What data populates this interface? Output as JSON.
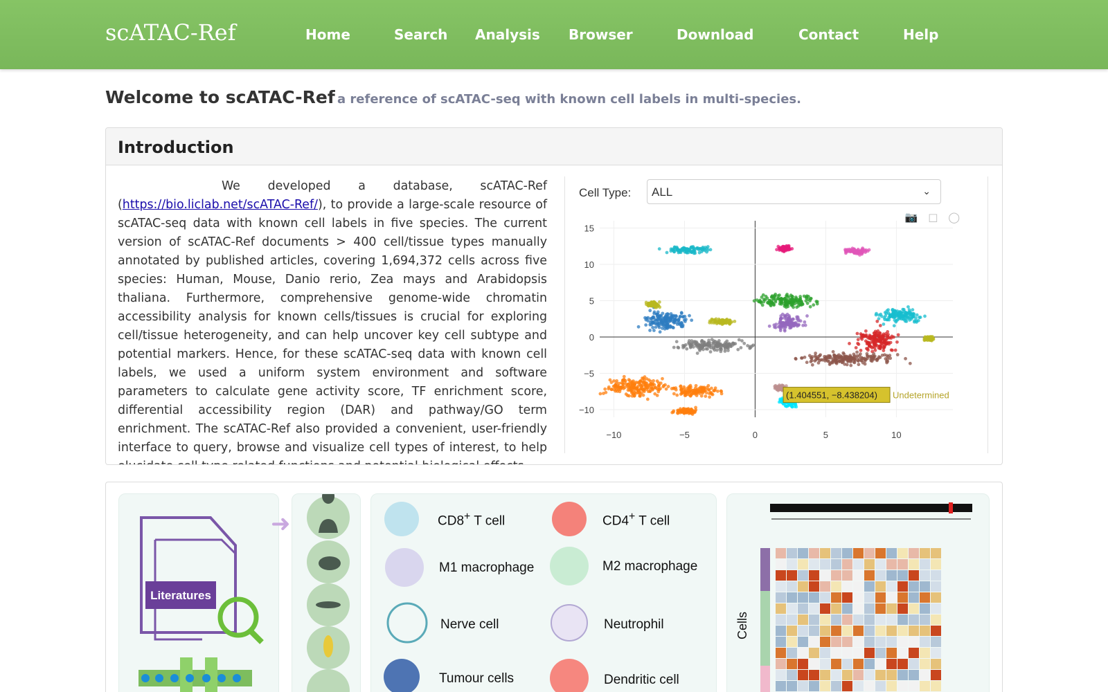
{
  "brand": "scATAC-Ref",
  "nav": [
    "Home",
    "Search",
    "Analysis",
    "Browser",
    "Download",
    "Contact",
    "Help"
  ],
  "welcome": {
    "title": "Welcome to scATAC-Ref",
    "subtitle": "a reference of scATAC-seq with known cell labels in multi-species."
  },
  "intro": {
    "heading": "Introduction",
    "text_before": "We developed a database, scATAC-Ref (",
    "link": "https://bio.liclab.net/scATAC-Ref/",
    "text_after": "), to provide a large-scale resource of scATAC-seq data with known cell labels in five species. The current version of scATAC-Ref documents > 400 cell/tissue types manually annotated by published articles, covering 1,694,372 cells across five species: Human, Mouse, Danio rerio, Zea mays and Arabidopsis thaliana. Furthermore, comprehensive genome-wide chromatin accessibility analysis for known cells/tissues is crucial for exploring cell/tissue heterogeneity, and can help uncover key cell subtype and potential markers. Hence, for these scATAC-seq data with known cell labels, we used a uniform system environment and software parameters to calculate gene activity score, TF enrichment score, differential accessibility region (DAR) and pathway/GO term enrichment. The scATAC-Ref also provided a convenient, user-friendly interface to query, browse and visualize cell types of interest, to help elucidate cell type related functions and potential biological effects."
  },
  "celltype": {
    "label": "Cell Type:",
    "value": "ALL"
  },
  "tooltip": {
    "text": "(1.404551, −8.438204)",
    "label": "Undetermined"
  },
  "chart_data": {
    "type": "scatter",
    "title": "",
    "xlabel": "",
    "ylabel": "",
    "xlim": [
      -11,
      14
    ],
    "ylim": [
      -12,
      16
    ],
    "x_ticks": [
      "−10",
      "−5",
      "0",
      "5",
      "10"
    ],
    "y_ticks": [
      "15",
      "10",
      "5",
      "0",
      "−5",
      "−10"
    ],
    "clusters": [
      {
        "color": "#1ab8c8",
        "x": -4.5,
        "y": 12,
        "sx": 1.3,
        "sy": 0.35
      },
      {
        "color": "#e6197a",
        "x": 2.1,
        "y": 12.2,
        "sx": 0.35,
        "sy": 0.25
      },
      {
        "color": "#e055b8",
        "x": 7.2,
        "y": 11.8,
        "sx": 0.7,
        "sy": 0.3
      },
      {
        "color": "#2e7cc0",
        "x": -6.3,
        "y": 2.2,
        "sx": 1.3,
        "sy": 1.0
      },
      {
        "color": "#b8b820",
        "x": -2.3,
        "y": 2.1,
        "sx": 0.6,
        "sy": 0.3
      },
      {
        "color": "#b8b820",
        "x": -7.2,
        "y": 4.5,
        "sx": 0.4,
        "sy": 0.3
      },
      {
        "color": "#2ca02c",
        "x": 2.2,
        "y": 5.0,
        "sx": 1.6,
        "sy": 0.7
      },
      {
        "color": "#9467bd",
        "x": 2.3,
        "y": 2.0,
        "sx": 0.8,
        "sy": 0.8
      },
      {
        "color": "#7f7f7f",
        "x": -3.0,
        "y": -1.2,
        "sx": 2.0,
        "sy": 0.6
      },
      {
        "color": "#17becf",
        "x": 10.2,
        "y": 3.0,
        "sx": 1.3,
        "sy": 0.8
      },
      {
        "color": "#d62728",
        "x": 8.6,
        "y": -0.3,
        "sx": 1.0,
        "sy": 1.3
      },
      {
        "color": "#8c564b",
        "x": 6.5,
        "y": -3.0,
        "sx": 2.8,
        "sy": 0.6
      },
      {
        "color": "#b8b820",
        "x": 12.3,
        "y": -0.2,
        "sx": 0.3,
        "sy": 0.25
      },
      {
        "color": "#ff7f0e",
        "x": -8.5,
        "y": -6.8,
        "sx": 1.7,
        "sy": 1.0
      },
      {
        "color": "#ff7f0e",
        "x": -4.2,
        "y": -7.4,
        "sx": 1.2,
        "sy": 0.6
      },
      {
        "color": "#ff7f0e",
        "x": -4.9,
        "y": -10.2,
        "sx": 0.7,
        "sy": 0.3
      },
      {
        "color": "#00e5ff",
        "x": 2.3,
        "y": -8.9,
        "sx": 0.5,
        "sy": 0.6
      },
      {
        "color": "#bc8f8f",
        "x": 1.8,
        "y": -7.0,
        "sx": 0.3,
        "sy": 0.3
      }
    ]
  },
  "figure": {
    "literatures": "Literatures",
    "cells_axis": "Cells",
    "cell_types": [
      {
        "name": "CD8",
        "sup": "+",
        "suffix": " T cell"
      },
      {
        "name": "CD4",
        "sup": "+",
        "suffix": " T cell"
      },
      {
        "name": "M1 macrophage",
        "sup": "",
        "suffix": ""
      },
      {
        "name": "M2 macrophage",
        "sup": "",
        "suffix": ""
      },
      {
        "name": "Nerve cell",
        "sup": "",
        "suffix": ""
      },
      {
        "name": "Neutrophil",
        "sup": "",
        "suffix": ""
      },
      {
        "name": "Tumour cells",
        "sup": "",
        "suffix": ""
      },
      {
        "name": "Dendritic cell",
        "sup": "",
        "suffix": ""
      }
    ],
    "species_icons": [
      "human-icon",
      "mouse-icon",
      "fish-icon",
      "corn-icon",
      "plant-icon"
    ],
    "colors": {
      "accent": "#7dbd5e",
      "purple": "#6a3f99",
      "green": "#6cbf3a"
    }
  }
}
